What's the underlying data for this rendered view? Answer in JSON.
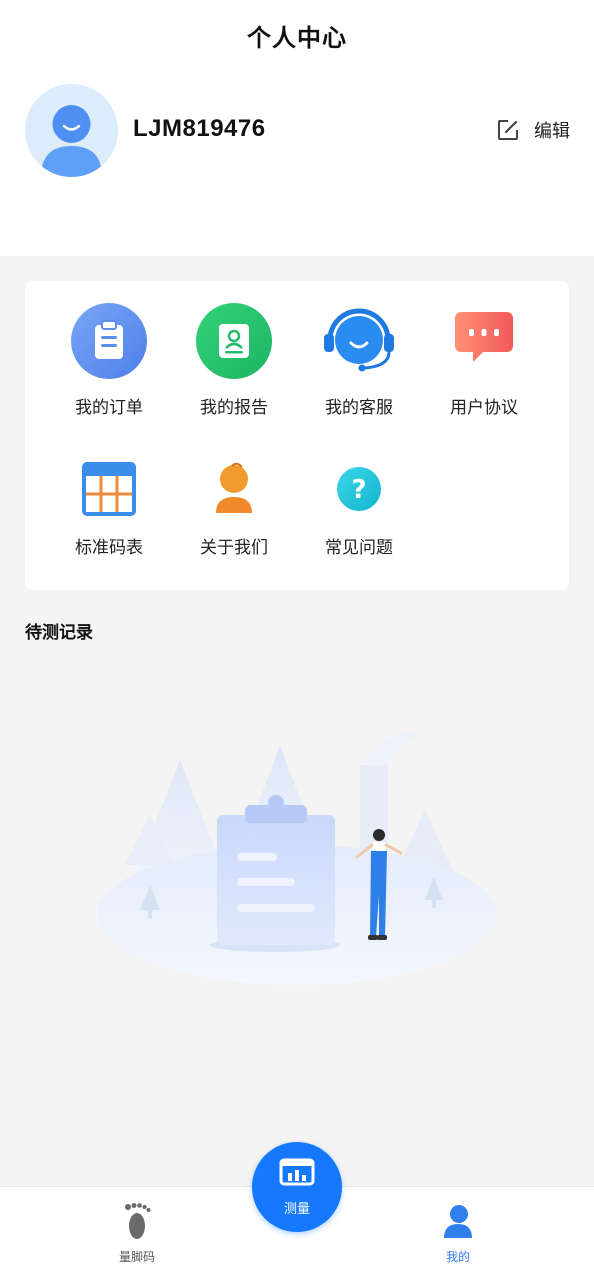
{
  "header": {
    "title": "个人中心"
  },
  "profile": {
    "username": "LJM819476",
    "edit_label": "编辑",
    "avatar_icon": "user-avatar-icon"
  },
  "menu": {
    "items": [
      {
        "label": "我的订单",
        "icon": "order-clipboard-icon"
      },
      {
        "label": "我的报告",
        "icon": "report-icon"
      },
      {
        "label": "我的客服",
        "icon": "customer-service-headset-icon"
      },
      {
        "label": "用户协议",
        "icon": "chat-bubble-icon"
      },
      {
        "label": "标准码表",
        "icon": "size-table-icon"
      },
      {
        "label": "关于我们",
        "icon": "about-person-icon"
      },
      {
        "label": "常见问题",
        "icon": "question-icon"
      }
    ]
  },
  "pending": {
    "title": "待测记录",
    "illustration": "empty-clipboard-illustration"
  },
  "tabbar": {
    "items": [
      {
        "label": "量脚码",
        "icon": "footprint-icon",
        "active": false
      },
      {
        "label": "测量",
        "icon": "measure-icon",
        "active": false
      },
      {
        "label": "我的",
        "icon": "profile-icon",
        "active": true
      }
    ]
  },
  "colors": {
    "primary": "#1677ff",
    "active_tab": "#2f80ed",
    "background": "#f4f4f4"
  }
}
